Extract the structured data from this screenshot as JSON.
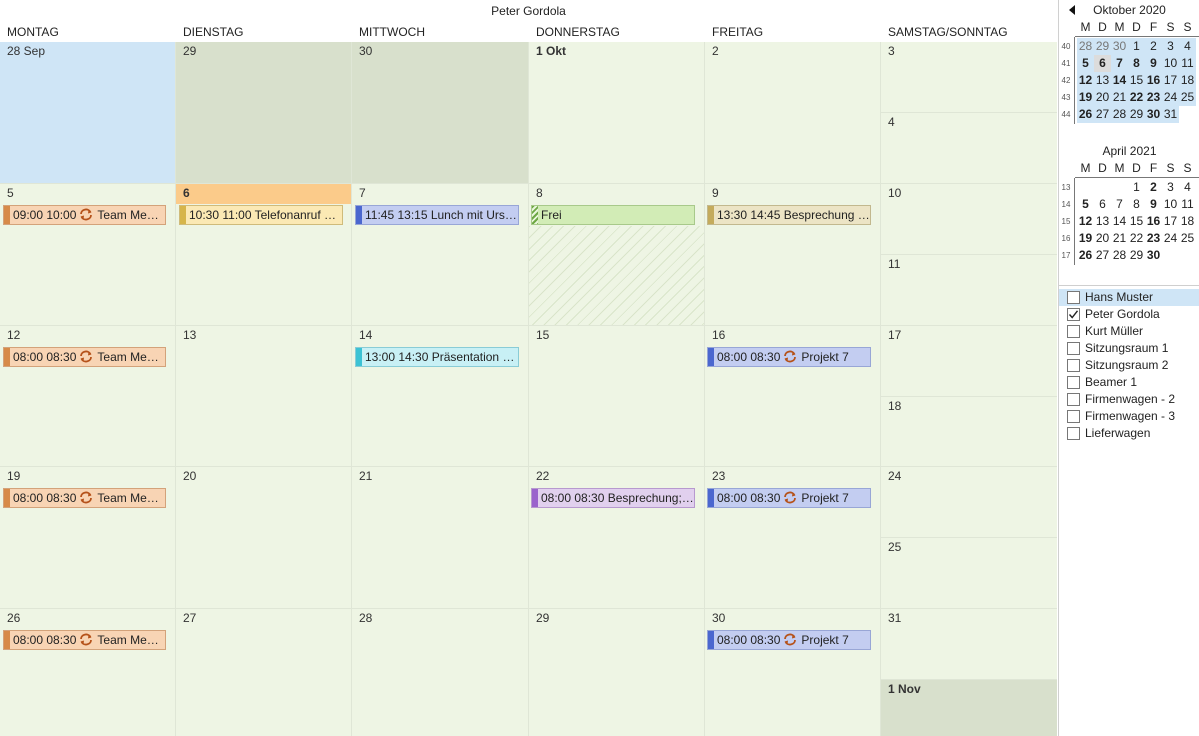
{
  "calendar": {
    "title": "Peter Gordola",
    "day_headers": [
      "MONTAG",
      "DIENSTAG",
      "MITTWOCH",
      "DONNERSTAG",
      "FREITAG",
      "SAMSTAG/SONNTAG"
    ],
    "weeks": [
      {
        "days": [
          "28 Sep",
          "29",
          "30",
          "1 Okt",
          "2"
        ],
        "weekend": [
          "3",
          "4"
        ]
      },
      {
        "days": [
          "5",
          "6",
          "7",
          "8",
          "9"
        ],
        "weekend": [
          "10",
          "11"
        ]
      },
      {
        "days": [
          "12",
          "13",
          "14",
          "15",
          "16"
        ],
        "weekend": [
          "17",
          "18"
        ]
      },
      {
        "days": [
          "19",
          "20",
          "21",
          "22",
          "23"
        ],
        "weekend": [
          "24",
          "25"
        ]
      },
      {
        "days": [
          "26",
          "27",
          "28",
          "29",
          "30"
        ],
        "weekend": [
          "31",
          "1 Nov"
        ]
      }
    ],
    "events": [
      {
        "name": "event-team-meeting-1",
        "label": "09:00 10:00",
        "title": "Team Meeting",
        "recurring": true
      },
      {
        "name": "event-telefonanruf",
        "label": "10:30 11:00 Telefonanruf H...",
        "title": "",
        "recurring": false
      },
      {
        "name": "event-lunch",
        "label": "11:45 13:15 Lunch mit Urs S...",
        "title": "",
        "recurring": false
      },
      {
        "name": "event-frei",
        "label": "Frei",
        "title": "",
        "recurring": false
      },
      {
        "name": "event-besprechung-1",
        "label": "13:30 14:45 Besprechung P...",
        "title": "",
        "recurring": false
      },
      {
        "name": "event-team-meeting-2",
        "label": "08:00 08:30",
        "title": "Team Meeting",
        "recurring": true
      },
      {
        "name": "event-praesentation",
        "label": "13:00 14:30 Präsentation Dr...",
        "title": "",
        "recurring": false
      },
      {
        "name": "event-projekt-1",
        "label": "08:00 08:30",
        "title": "Projekt 7",
        "recurring": true
      },
      {
        "name": "event-team-meeting-3",
        "label": "08:00 08:30",
        "title": "Team Meeting",
        "recurring": true
      },
      {
        "name": "event-besprechung-2",
        "label": "08:00 08:30 Besprechung; B...",
        "title": "",
        "recurring": false
      },
      {
        "name": "event-projekt-2",
        "label": "08:00 08:30",
        "title": "Projekt 7",
        "recurring": true
      },
      {
        "name": "event-team-meeting-4",
        "label": "08:00 08:30",
        "title": "Team Meeting",
        "recurring": true
      },
      {
        "name": "event-projekt-3",
        "label": "08:00 08:30",
        "title": "Projekt 7",
        "recurring": true
      }
    ]
  },
  "mini_calendars": [
    {
      "title": "Oktober 2020",
      "dow": [
        "M",
        "D",
        "M",
        "D",
        "F",
        "S",
        "S"
      ],
      "weeks": [
        {
          "wk": "40",
          "days": [
            "28",
            "29",
            "30",
            "1",
            "2",
            "3",
            "4"
          ]
        },
        {
          "wk": "41",
          "days": [
            "5",
            "6",
            "7",
            "8",
            "9",
            "10",
            "11"
          ]
        },
        {
          "wk": "42",
          "days": [
            "12",
            "13",
            "14",
            "15",
            "16",
            "17",
            "18"
          ]
        },
        {
          "wk": "43",
          "days": [
            "19",
            "20",
            "21",
            "22",
            "23",
            "24",
            "25"
          ]
        },
        {
          "wk": "44",
          "days": [
            "26",
            "27",
            "28",
            "29",
            "30",
            "31",
            ""
          ]
        }
      ]
    },
    {
      "title": "April 2021",
      "dow": [
        "M",
        "D",
        "M",
        "D",
        "F",
        "S",
        "S"
      ],
      "weeks": [
        {
          "wk": "13",
          "days": [
            "",
            "",
            "",
            "1",
            "2",
            "3",
            "4"
          ]
        },
        {
          "wk": "14",
          "days": [
            "5",
            "6",
            "7",
            "8",
            "9",
            "10",
            "11"
          ]
        },
        {
          "wk": "15",
          "days": [
            "12",
            "13",
            "14",
            "15",
            "16",
            "17",
            "18"
          ]
        },
        {
          "wk": "16",
          "days": [
            "19",
            "20",
            "21",
            "22",
            "23",
            "24",
            "25"
          ]
        },
        {
          "wk": "17",
          "days": [
            "26",
            "27",
            "28",
            "29",
            "30",
            "",
            ""
          ]
        }
      ]
    }
  ],
  "resources": [
    {
      "label": "Hans Muster",
      "checked": false,
      "highlighted": true
    },
    {
      "label": "Peter Gordola",
      "checked": true,
      "highlighted": false
    },
    {
      "label": "Kurt Müller",
      "checked": false,
      "highlighted": false
    },
    {
      "label": "Sitzungsraum 1",
      "checked": false,
      "highlighted": false
    },
    {
      "label": "Sitzungsraum 2",
      "checked": false,
      "highlighted": false
    },
    {
      "label": "Beamer 1",
      "checked": false,
      "highlighted": false
    },
    {
      "label": "Firmenwagen - 2",
      "checked": false,
      "highlighted": false
    },
    {
      "label": "Firmenwagen - 3",
      "checked": false,
      "highlighted": false
    },
    {
      "label": "Lieferwagen",
      "checked": false,
      "highlighted": false
    }
  ],
  "colors": {
    "calendar_bg": "#eef5e4",
    "selected_week_bg": "#cfe5f6",
    "past_bg": "#d8e0cc",
    "today_header": "#fbcb8a"
  },
  "icons": {
    "recurrence": "recurrence-icon",
    "prev_month": "chevron-left-icon",
    "checkmark": "checkmark-icon"
  }
}
